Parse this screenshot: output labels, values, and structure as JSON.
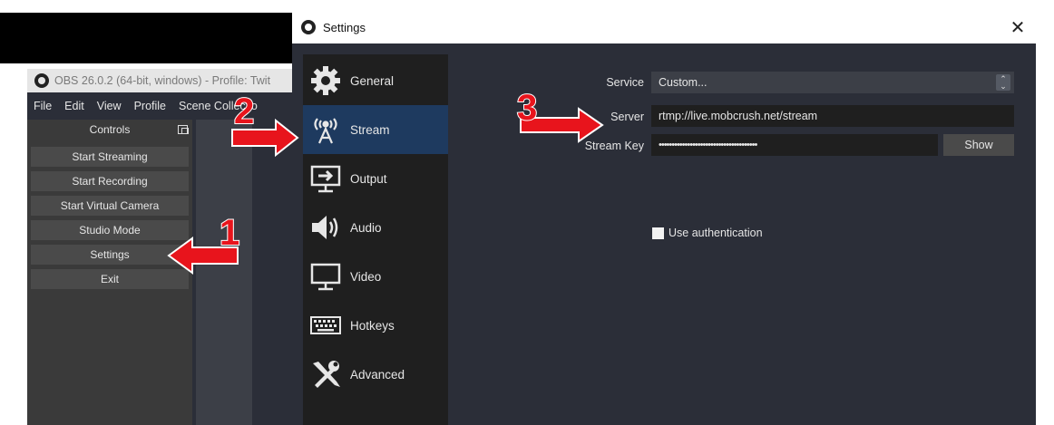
{
  "obs_main": {
    "title": "OBS 26.0.2 (64-bit, windows) - Profile: Twit",
    "menu": [
      "File",
      "Edit",
      "View",
      "Profile",
      "Scene Collectio"
    ],
    "controls_header": "Controls",
    "controls": [
      "Start Streaming",
      "Start Recording",
      "Start Virtual Camera",
      "Studio Mode",
      "Settings",
      "Exit"
    ]
  },
  "settings": {
    "title": "Settings",
    "close_icon": "close-icon",
    "nav": [
      {
        "label": "General",
        "icon": "gear-icon"
      },
      {
        "label": "Stream",
        "icon": "broadcast-antenna-icon",
        "active": true
      },
      {
        "label": "Output",
        "icon": "output-monitor-icon"
      },
      {
        "label": "Audio",
        "icon": "speaker-icon"
      },
      {
        "label": "Video",
        "icon": "monitor-icon"
      },
      {
        "label": "Hotkeys",
        "icon": "keyboard-icon"
      },
      {
        "label": "Advanced",
        "icon": "tools-icon"
      }
    ],
    "stream": {
      "service_label": "Service",
      "service_value": "Custom...",
      "server_label": "Server",
      "server_value": "rtmp://live.mobcrush.net/stream",
      "stream_key_label": "Stream Key",
      "stream_key_value": "••••••••••••••••••••••••••••••••••••••",
      "show_button": "Show",
      "use_auth_label": "Use authentication",
      "use_auth_checked": false
    }
  },
  "annotations": {
    "step1": "1",
    "step2": "2",
    "step3": "3",
    "arrow_color": "#e8141c"
  }
}
